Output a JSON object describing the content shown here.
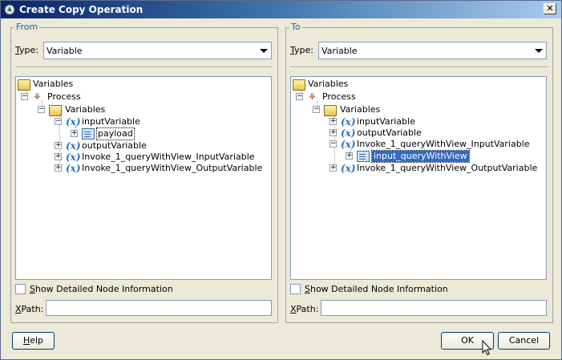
{
  "window": {
    "title": "Create Copy Operation",
    "close_glyph": "✕"
  },
  "from": {
    "legend": "From",
    "type_label_prefix": "",
    "type_label_accel": "T",
    "type_label_rest": "ype:",
    "type_value": "Variable",
    "tree": {
      "root": "Variables",
      "process": "Process",
      "variables": "Variables",
      "inputVariable": "inputVariable",
      "payload": "payload",
      "outputVariable": "outputVariable",
      "invoke_input": "Invoke_1_queryWithView_InputVariable",
      "invoke_output": "Invoke_1_queryWithView_OutputVariable"
    },
    "checkbox_accel": "S",
    "checkbox_rest": "how Detailed Node Information",
    "xpath_accel": "X",
    "xpath_rest": "Path:",
    "xpath_value": ""
  },
  "to": {
    "legend": "To",
    "type_label_accel": "T",
    "type_label_rest": "ype:",
    "type_value": "Variable",
    "tree": {
      "root": "Variables",
      "process": "Process",
      "variables": "Variables",
      "inputVariable": "inputVariable",
      "outputVariable": "outputVariable",
      "invoke_input": "Invoke_1_queryWithView_InputVariable",
      "input_queryWithView": "input_queryWithView",
      "invoke_output": "Invoke_1_queryWithView_OutputVariable"
    },
    "checkbox_accel": "S",
    "checkbox_rest": "how Detailed Node Information",
    "xpath_accel": "X",
    "xpath_rest": "Path:",
    "xpath_value": ""
  },
  "buttons": {
    "help_accel": "H",
    "help_rest": "elp",
    "ok": "OK",
    "cancel": "Cancel"
  },
  "icons": {
    "expanded": "−",
    "collapsed": "+"
  }
}
